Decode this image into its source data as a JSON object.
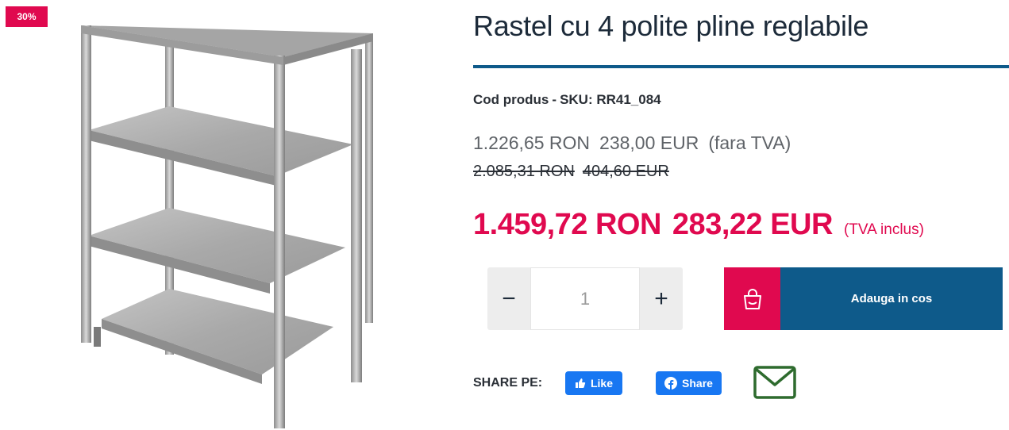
{
  "badge": {
    "discount": "30%"
  },
  "product": {
    "title": "Rastel cu 4 polite pline reglabile",
    "sku_label": "Cod produs",
    "sku_sep": "-",
    "sku_value": "SKU: RR41_084"
  },
  "prices": {
    "no_vat_ron": "1.226,65 RON",
    "no_vat_eur": "238,00 EUR",
    "no_vat_note": "(fara TVA)",
    "old_ron": "2.085,31 RON",
    "old_eur": "404,60 EUR",
    "final_ron": "1.459,72 RON",
    "final_eur": "283,22 EUR",
    "final_note": "(TVA inclus)"
  },
  "cart": {
    "minus": "−",
    "plus": "+",
    "quantity": "1",
    "add_label": "Adauga in cos"
  },
  "share": {
    "label": "SHARE PE:",
    "like": "Like",
    "share": "Share"
  },
  "colors": {
    "accent": "#e0094f",
    "brand_blue": "#0e5a8a",
    "facebook": "#1877f2",
    "mail_green": "#2e6b2e"
  },
  "icons": [
    "shopping-bag-icon",
    "thumbs-up-icon",
    "facebook-icon",
    "envelope-icon"
  ]
}
